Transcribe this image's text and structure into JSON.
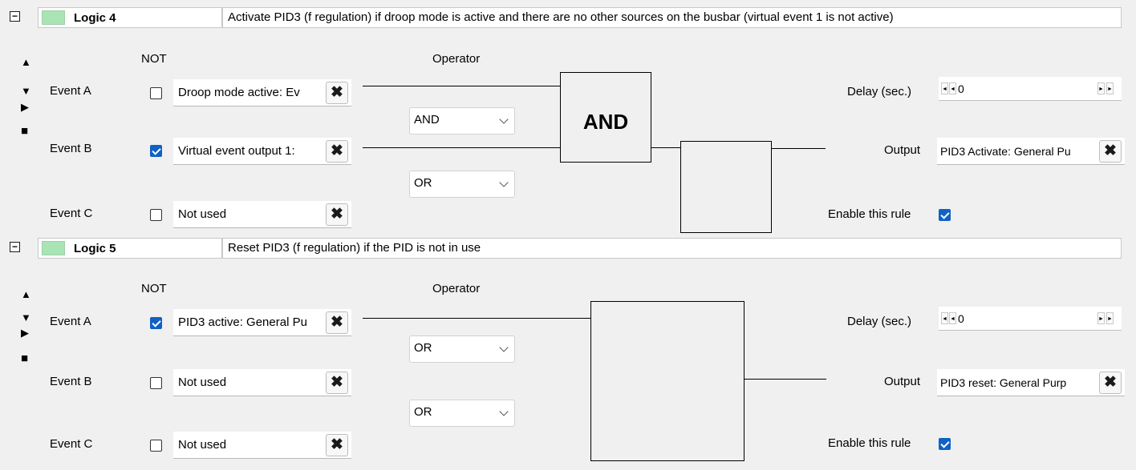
{
  "labels": {
    "not": "NOT",
    "operator": "Operator",
    "event_a": "Event A",
    "event_b": "Event B",
    "event_c": "Event C",
    "delay": "Delay (sec.)",
    "output": "Output",
    "enable": "Enable this rule",
    "collapse": "−",
    "arrow_up": "▲",
    "arrow_down": "▼",
    "arrow_right": "▶",
    "stop": "■",
    "remove": "✖",
    "spin_left": "◄",
    "spin_right": "►"
  },
  "logics": [
    {
      "title": "Logic 4",
      "description": "Activate PID3 (f regulation) if droop mode is active and there are no other sources on the busbar (virtual event 1 is not active)",
      "event_a": {
        "text": "Droop mode active: Ev",
        "not": false
      },
      "event_b": {
        "text": "Virtual event output 1:",
        "not": true
      },
      "event_c": {
        "text": "Not used",
        "not": false
      },
      "operator_ab": "AND",
      "operator_bc": "OR",
      "gate_label": "AND",
      "delay": "0",
      "output": "PID3 Activate: General Pu",
      "enabled": true
    },
    {
      "title": "Logic 5",
      "description": "Reset PID3 (f regulation) if the PID is not in use",
      "event_a": {
        "text": "PID3 active: General Pu",
        "not": true
      },
      "event_b": {
        "text": "Not used",
        "not": false
      },
      "event_c": {
        "text": "Not used",
        "not": false
      },
      "operator_ab": "OR",
      "operator_bc": "OR",
      "gate_label": "",
      "delay": "0",
      "output": "PID3 reset: General Purp",
      "enabled": true
    }
  ],
  "colors": {
    "swatch": "#a8e4b4",
    "checkbox_checked": "#0f62c4",
    "background": "#f0f0f0"
  }
}
